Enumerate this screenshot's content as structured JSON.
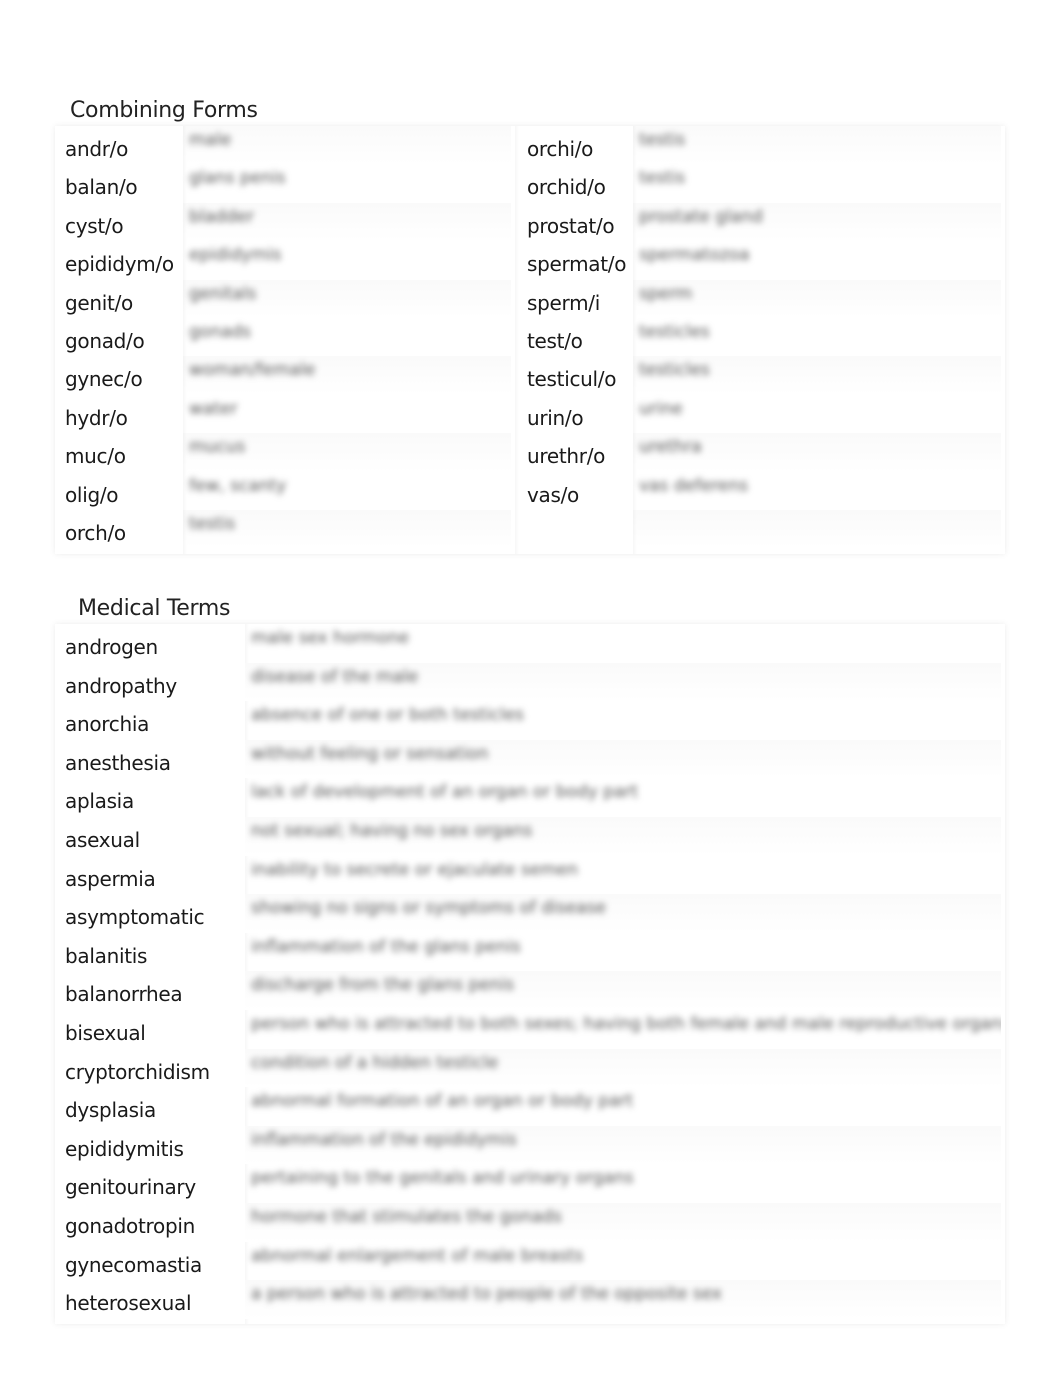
{
  "combining_forms": {
    "title": "Combining Forms",
    "left": [
      {
        "term": "andr/o",
        "definition": "male"
      },
      {
        "term": "balan/o",
        "definition": "glans penis"
      },
      {
        "term": "cyst/o",
        "definition": "bladder"
      },
      {
        "term": "epididym/o",
        "definition": "epididymis"
      },
      {
        "term": "genit/o",
        "definition": "genitals"
      },
      {
        "term": "gonad/o",
        "definition": "gonads"
      },
      {
        "term": "gynec/o",
        "definition": "woman/female"
      },
      {
        "term": "hydr/o",
        "definition": "water"
      },
      {
        "term": "muc/o",
        "definition": "mucus"
      },
      {
        "term": "olig/o",
        "definition": "few, scanty"
      },
      {
        "term": "orch/o",
        "definition": "testis"
      }
    ],
    "right": [
      {
        "term": "orchi/o",
        "definition": "testis"
      },
      {
        "term": "orchid/o",
        "definition": "testis"
      },
      {
        "term": "prostat/o",
        "definition": "prostate gland"
      },
      {
        "term": "spermat/o",
        "definition": "spermatozoa"
      },
      {
        "term": "sperm/i",
        "definition": "sperm"
      },
      {
        "term": "test/o",
        "definition": "testicles"
      },
      {
        "term": "testicul/o",
        "definition": "testicles"
      },
      {
        "term": "urin/o",
        "definition": "urine"
      },
      {
        "term": "urethr/o",
        "definition": "urethra"
      },
      {
        "term": "vas/o",
        "definition": "vas deferens"
      },
      {
        "term": "",
        "definition": ""
      }
    ]
  },
  "medical_terms": {
    "title": "Medical Terms",
    "rows": [
      {
        "term": "androgen",
        "definition": "male sex hormone"
      },
      {
        "term": "andropathy",
        "definition": "disease of the male"
      },
      {
        "term": "anorchia",
        "definition": "absence of one or both testicles"
      },
      {
        "term": "anesthesia",
        "definition": "without feeling or sensation"
      },
      {
        "term": "aplasia",
        "definition": "lack of development of an organ or body part"
      },
      {
        "term": "asexual",
        "definition": "not sexual; having no sex organs"
      },
      {
        "term": "aspermia",
        "definition": "inability to secrete or ejaculate semen"
      },
      {
        "term": "asymptomatic",
        "definition": "showing no signs or symptoms of disease"
      },
      {
        "term": "balanitis",
        "definition": "inflammation of the glans penis"
      },
      {
        "term": "balanorrhea",
        "definition": "discharge from the glans penis"
      },
      {
        "term": "bisexual",
        "definition": "person who is attracted to both sexes; having both female and male reproductive organs"
      },
      {
        "term": "cryptorchidism",
        "definition": "condition of a hidden testicle"
      },
      {
        "term": "dysplasia",
        "definition": "abnormal formation of an organ or body part"
      },
      {
        "term": "epididymitis",
        "definition": "inflammation of the epididymis"
      },
      {
        "term": "genitourinary",
        "definition": "pertaining to the genitals and urinary organs"
      },
      {
        "term": "gonadotropin",
        "definition": "hormone that stimulates the gonads"
      },
      {
        "term": "gynecomastia",
        "definition": "abnormal enlargement of male breasts"
      },
      {
        "term": "heterosexual",
        "definition": "a person who is attracted to people of the opposite sex"
      }
    ]
  }
}
